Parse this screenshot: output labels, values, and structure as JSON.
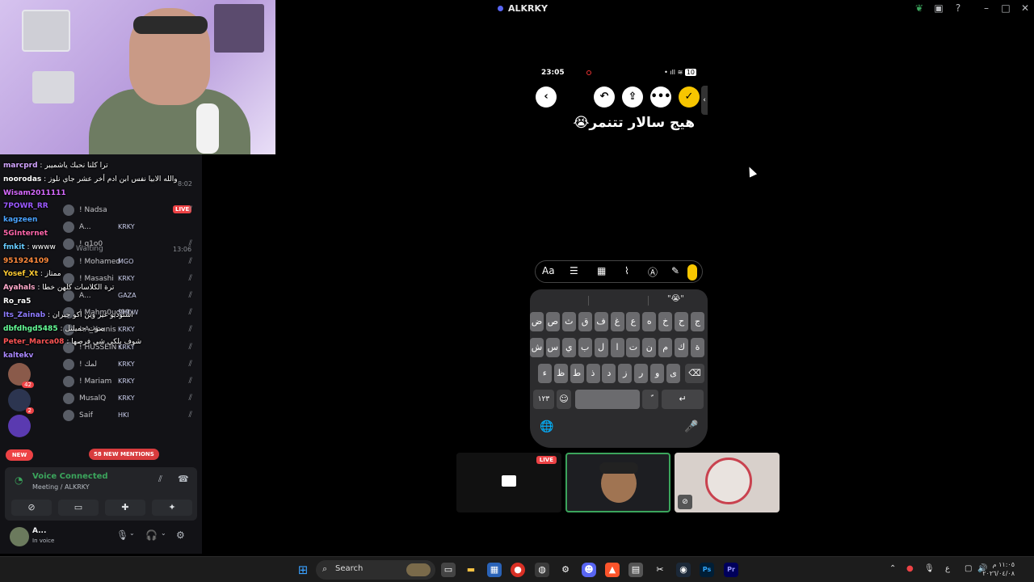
{
  "window": {
    "title": "ALKRKY"
  },
  "chat": [
    {
      "user": "marcprd",
      "msg": "ترا كلنا نحبك ياشميبر",
      "color": "#d2a4ff"
    },
    {
      "user": "noorodas",
      "msg": "والله الابيا نفس ابن ادم أخر عشر جاي نلوز",
      "color": "#ffffff"
    },
    {
      "user": "Wisam2011111",
      "msg": "",
      "color": "#d66aff"
    },
    {
      "user": "7POWR_RR",
      "msg": "",
      "color": "#9b59ff"
    },
    {
      "user": "kagzeen",
      "msg": "",
      "color": "#4aa3ff"
    },
    {
      "user": "5GInternet",
      "msg": "",
      "color": "#ff66aa"
    },
    {
      "user": "fmkit",
      "msg": "wwww",
      "color": "#66ccff"
    },
    {
      "user": "951924109",
      "msg": "",
      "color": "#ff8a3c"
    },
    {
      "user": "Yosef_Xt",
      "msg": "ممتاز",
      "color": "#ffcc33"
    },
    {
      "user": "Ayahals",
      "msg": "ترة الكلاسات كلهن خطا",
      "color": "#ffaacc"
    },
    {
      "user": "Ro_ra5",
      "msg": "",
      "color": "#ffffff"
    },
    {
      "user": "Its_Zainab",
      "msg": "استوديو غير وين اكو جبران",
      "color": "#8e7bff"
    },
    {
      "user": "dbfdhgd5485",
      "msg": "صوت جميلتل",
      "color": "#66ff99"
    },
    {
      "user": "Peter_Marca08",
      "msg": "شوف بلكي شي فرصها",
      "color": "#ff5555"
    },
    {
      "user": "kaltekv",
      "msg": "",
      "color": "#aa88ff"
    }
  ],
  "discord": {
    "channel_time": "8:02",
    "waiting_label": "Waiting",
    "waiting_time": "13:06",
    "live_badge": "LIVE",
    "members": [
      {
        "name": "! Nadsa",
        "badge": "",
        "muted": true
      },
      {
        "name": "A...",
        "badge": "KRKY",
        "muted": false
      },
      {
        "name": "! q1o0",
        "badge": "",
        "muted": true
      },
      {
        "name": "! Mohamed",
        "badge": "MGO",
        "muted": true
      },
      {
        "name": "! Masashi",
        "badge": "KRKY",
        "muted": true
      },
      {
        "name": "A...",
        "badge": "GAZA",
        "muted": true
      },
      {
        "name": "! Mahm0ud99",
        "badge": "SHDW",
        "muted": true
      },
      {
        "name": "! A_Younis",
        "badge": "KRKY",
        "muted": true
      },
      {
        "name": "! HUSSEIN !",
        "badge": "KRKY",
        "muted": true
      },
      {
        "name": "! لمك",
        "badge": "KRKY",
        "muted": true
      },
      {
        "name": "! Mariam",
        "badge": "KRKY",
        "muted": true
      },
      {
        "name": "MusalQ",
        "badge": "KRKY",
        "muted": true
      },
      {
        "name": "Saif",
        "badge": "HKI",
        "muted": true
      }
    ],
    "server_badges": [
      "42",
      "2"
    ],
    "new_label": "NEW",
    "mentions_label": "58 NEW MENTIONS",
    "voice": {
      "status": "Voice Connected",
      "location": "Meeting / ALKRKY"
    },
    "user": {
      "name": "A...",
      "status": "In voice"
    }
  },
  "phone": {
    "time": "23:05",
    "battery": "10",
    "note_text": "هيج سالار تتنمر😭",
    "suggestion": "\"😭\"",
    "keyboard_rows": [
      [
        "ج",
        "ح",
        "خ",
        "ه",
        "ع",
        "غ",
        "ف",
        "ق",
        "ث",
        "ص",
        "ض"
      ],
      [
        "ة",
        "ك",
        "م",
        "ن",
        "ت",
        "ا",
        "ل",
        "ب",
        "ي",
        "س",
        "ش"
      ],
      [
        "ى",
        "و",
        "ر",
        "ز",
        "د",
        "ذ",
        "ط",
        "ظ",
        "ء"
      ]
    ],
    "num_key": "١٢٣",
    "format_label": "Aa"
  },
  "tiles": {
    "live_label": "LIVE"
  },
  "taskbar": {
    "search_label": "Search",
    "clock_time": "١١:٠٥ م",
    "clock_date": "٢٠٢٦/٠٤/٠٨",
    "lang": "ع"
  }
}
